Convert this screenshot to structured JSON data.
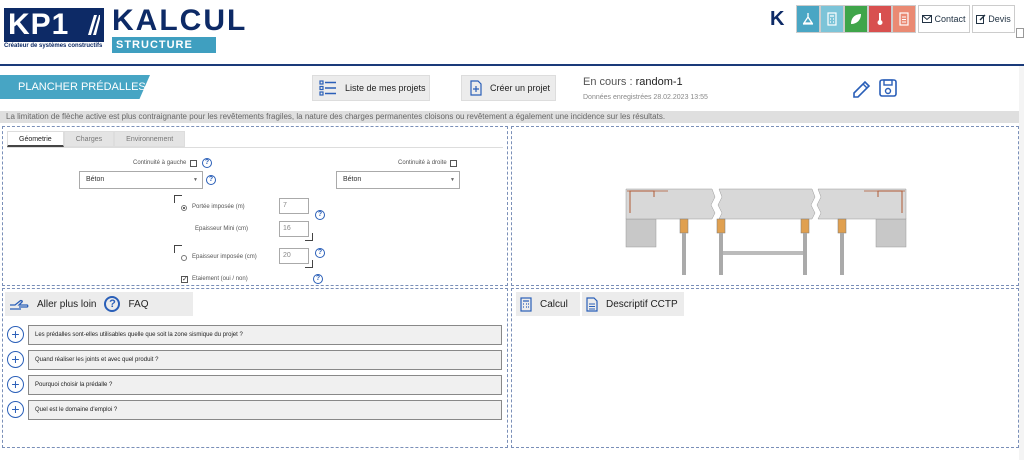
{
  "header": {
    "logo_main": "KP1",
    "logo_tagline": "Créateur de systèmes constructifs",
    "logo_app": "KALCUL",
    "logo_sub": "STRUCTURE",
    "k_letter": "K",
    "contact_label": "Contact",
    "devis_label": "Devis",
    "tool_colors": [
      "#4aa6c4",
      "#7cc4d8",
      "#3fa54a",
      "#d8504f",
      "#ea8a73"
    ]
  },
  "toolbar": {
    "title": "PLANCHER PRÉDALLES",
    "list_label": "Liste de mes projets",
    "create_label": "Créer un projet",
    "encours_prefix": "En cours : ",
    "encours_name": "random-1",
    "saved_text": "Données enregistrées 28.02.2023 13:55"
  },
  "info_text": "La limitation de flèche active est plus contraignante pour les revêtements fragiles, la nature des charges permanentes cloisons ou revêtement a également une incidence sur les résultats.",
  "geometry": {
    "tabs": [
      "Géometrie",
      "Charges",
      "Environnement"
    ],
    "continuity_left": "Continuité à gauche",
    "continuity_right": "Continuité à droite",
    "select_left": "Béton",
    "select_right": "Béton",
    "portee_label": "Portée imposée (m)",
    "portee_value": "7",
    "epaisseur_mini_label": "Epaisseur Mini (cm)",
    "epaisseur_mini_value": "16",
    "epaisseur_imposee_label": "Epaisseur imposée (cm)",
    "epaisseur_imposee_value": "20",
    "etaiement_label": "Etaiement (oui / non)"
  },
  "faq": {
    "aller_label": "Aller plus loin",
    "faq_label": "FAQ",
    "questions": [
      "Les prédalles sont-elles utilisables quelle que soit la zone sismique du projet ?",
      "Quand réaliser les joints et avec quel produit ?",
      "Pourquoi choisir la prédalle ?",
      "Quel est le domaine d'emploi ?"
    ]
  },
  "calc": {
    "calcul_label": "Calcul",
    "cctp_label": "Descriptif CCTP"
  }
}
